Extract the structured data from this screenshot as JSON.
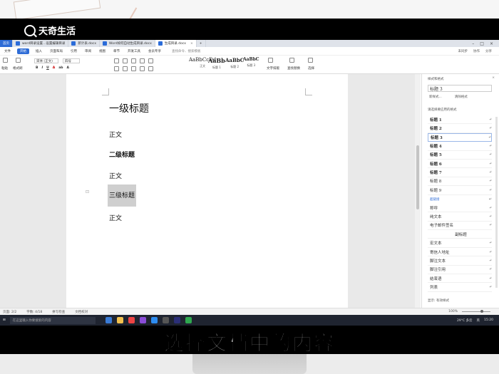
{
  "overlay": {
    "brand": "天奇生活",
    "subtitle": "选择文档中的内容"
  },
  "tabs": [
    {
      "label": "首页"
    },
    {
      "label": "word目录设置...设置编辑目录"
    },
    {
      "label": "新计表.docx"
    },
    {
      "label": "Word如何自动生成目录.docx"
    },
    {
      "label": "生成目录.docx"
    }
  ],
  "window_right": {
    "login": "未登录",
    "collab": "协作"
  },
  "menu": {
    "items": [
      "文件",
      "开始",
      "插入",
      "页面布局",
      "引用",
      "审阅",
      "视图",
      "章节",
      "开发工具",
      "会员专享"
    ],
    "active": "开始",
    "search": "查找命令、搜索模板",
    "right": [
      "未同步",
      "协作",
      "分享"
    ]
  },
  "ribbon": {
    "paste": "粘贴",
    "format_painter": "格式刷",
    "font_name": "宋体 (正文)",
    "font_size": "四号",
    "styles": [
      {
        "sample": "AaBbCcDd",
        "caption": "正文"
      },
      {
        "sample": "AaBb",
        "caption": "标题 1"
      },
      {
        "sample": "AaBbC",
        "caption": "标题 2"
      },
      {
        "sample": "AaBbC",
        "caption": "标题 3"
      }
    ],
    "text_layout": "文字排版",
    "find_replace": "查找替换",
    "select": "选择"
  },
  "document": {
    "lines": {
      "h1": "一级标题",
      "body1": "正文",
      "h2": "二级标题",
      "body2": "正文",
      "h3": "三级标题",
      "body3": "正文"
    }
  },
  "style_pane": {
    "title": "样式和格式",
    "current": "标题 3",
    "new_style": "新样式...",
    "clear_format": "清除格式",
    "section_label": "请选择要应用的格式",
    "styles": [
      {
        "name": "标题 1",
        "kind": "bold"
      },
      {
        "name": "标题 2",
        "kind": "bold"
      },
      {
        "name": "标题 3",
        "kind": "bold-selected"
      },
      {
        "name": "标题 4",
        "kind": "bold"
      },
      {
        "name": "标题 5",
        "kind": "bold"
      },
      {
        "name": "标题 6",
        "kind": "bold"
      },
      {
        "name": "标题 7",
        "kind": "bold"
      },
      {
        "name": "标题 8",
        "kind": "plain"
      },
      {
        "name": "标题 9",
        "kind": "plain"
      },
      {
        "name": "超链接",
        "kind": "link"
      },
      {
        "name": "称呼",
        "kind": "plain"
      },
      {
        "name": "纯文本",
        "kind": "plain"
      },
      {
        "name": "电子邮件签名",
        "kind": "plain"
      },
      {
        "name": "副标题",
        "kind": "center"
      },
      {
        "name": "宏文本",
        "kind": "plain"
      },
      {
        "name": "寄信人地址",
        "kind": "plain"
      },
      {
        "name": "脚注文本",
        "kind": "plain"
      },
      {
        "name": "脚注引用",
        "kind": "plain"
      },
      {
        "name": "结束语",
        "kind": "plain"
      },
      {
        "name": "列表",
        "kind": "plain"
      }
    ],
    "show_label": "显示: 有效样式"
  },
  "statusbar": {
    "page": "页面: 2/2",
    "words": "字数: 4/18",
    "spell": "拼写检查",
    "doc_check": "文档校对",
    "zoom": "100%"
  },
  "taskbar": {
    "search_placeholder": "在这里输入你要搜索的内容",
    "weather": "29°C 多云",
    "lang": "英",
    "time": "15:20"
  },
  "colors": {
    "accent": "#2e6cd6",
    "selection": "#cfcfcf",
    "taskbar": "#1f2430"
  }
}
